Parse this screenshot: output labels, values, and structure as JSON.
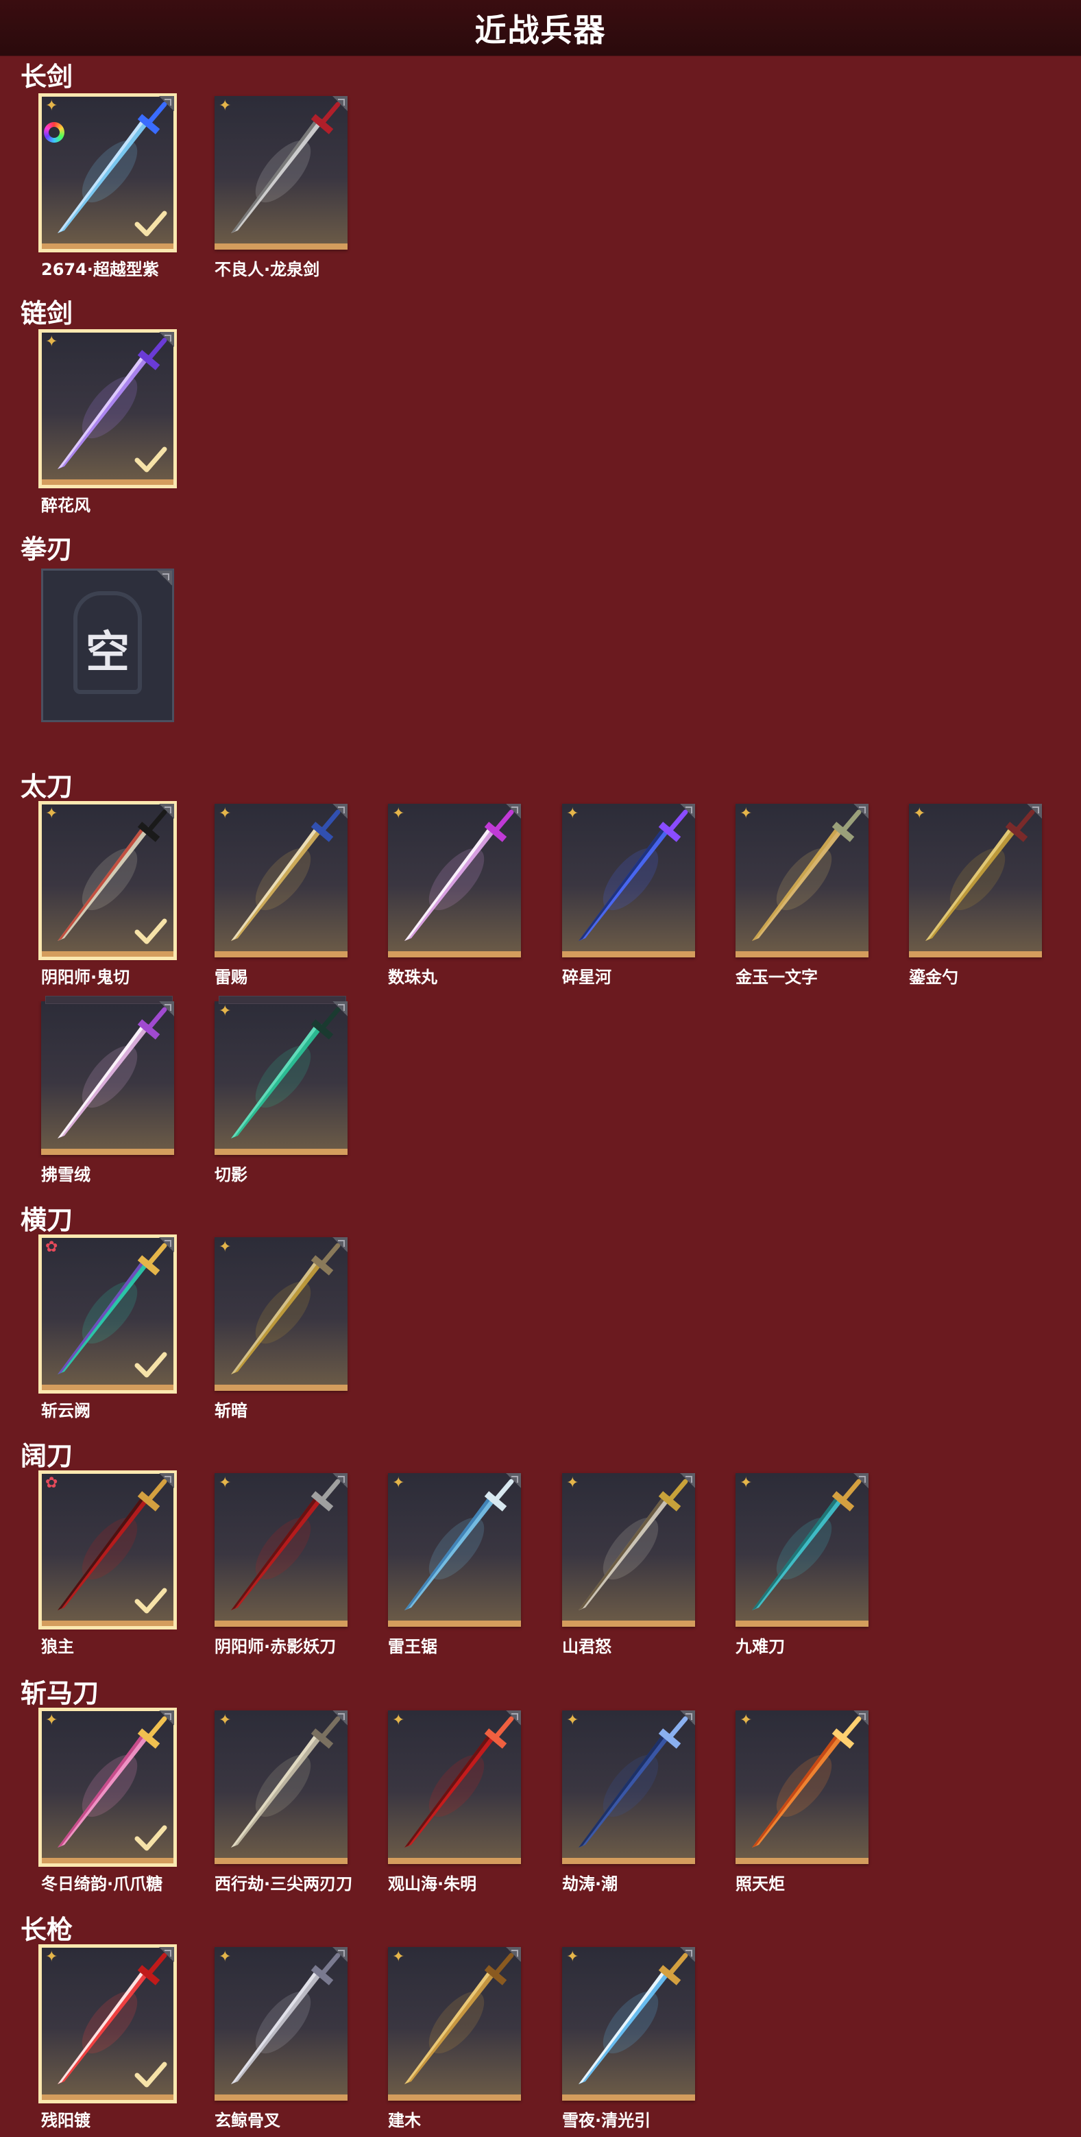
{
  "title": "近战兵器",
  "colors": {
    "background": "#6b1a1f",
    "card_bottom": "#d49d5d",
    "selected": "#fbe8b0",
    "rarity_gold": "#e5b54a",
    "rarity_red": "#e64a5a"
  },
  "sections": [
    {
      "name": "长剑",
      "items": [
        {
          "label": "2674·超越型紫",
          "rarity": "gold",
          "selected": true,
          "badge": "rainbow-ring"
        },
        {
          "label": "不良人·龙泉剑",
          "rarity": "gold",
          "selected": false
        }
      ]
    },
    {
      "name": "链剑",
      "items": [
        {
          "label": "醉花风",
          "rarity": "gold",
          "selected": true
        }
      ]
    },
    {
      "name": "拳刃",
      "items": [
        {
          "label": "",
          "empty_text": "空",
          "empty": true
        }
      ]
    },
    {
      "name": "太刀",
      "items": [
        {
          "label": "阴阳师·鬼切",
          "rarity": "gold",
          "selected": true
        },
        {
          "label": "雷赐",
          "rarity": "gold",
          "selected": false
        },
        {
          "label": "数珠丸",
          "rarity": "gold",
          "selected": false
        },
        {
          "label": "碎星河",
          "rarity": "gold",
          "selected": false
        },
        {
          "label": "金玉一文字",
          "rarity": "gold",
          "selected": false
        },
        {
          "label": "鎏金勺",
          "rarity": "gold",
          "selected": false
        },
        {
          "label": "拂雪绒",
          "rarity": "none",
          "selected": false,
          "stack": true
        },
        {
          "label": "切影",
          "rarity": "gold",
          "selected": false,
          "stack": true
        }
      ]
    },
    {
      "name": "横刀",
      "items": [
        {
          "label": "斩云阙",
          "rarity": "red",
          "selected": true
        },
        {
          "label": "斩暗",
          "rarity": "gold",
          "selected": false
        }
      ]
    },
    {
      "name": "阔刀",
      "items": [
        {
          "label": "狼主",
          "rarity": "red",
          "selected": true
        },
        {
          "label": "阴阳师·赤影妖刀",
          "rarity": "gold",
          "selected": false
        },
        {
          "label": "雷王锯",
          "rarity": "gold",
          "selected": false
        },
        {
          "label": "山君怒",
          "rarity": "gold",
          "selected": false
        },
        {
          "label": "九难刀",
          "rarity": "gold",
          "selected": false
        }
      ]
    },
    {
      "name": "斩马刀",
      "items": [
        {
          "label": "冬日绮韵·爪爪糖",
          "rarity": "gold",
          "selected": true
        },
        {
          "label": "西行劫·三尖两刃刀",
          "rarity": "gold",
          "selected": false
        },
        {
          "label": "观山海·朱明",
          "rarity": "gold",
          "selected": false
        },
        {
          "label": "劫涛·潮",
          "rarity": "gold",
          "selected": false
        },
        {
          "label": "照天炬",
          "rarity": "gold",
          "selected": false
        }
      ]
    },
    {
      "name": "长枪",
      "items": [
        {
          "label": "残阳镀",
          "rarity": "gold",
          "selected": true
        },
        {
          "label": "玄鲸骨叉",
          "rarity": "gold",
          "selected": false
        },
        {
          "label": "建木",
          "rarity": "gold",
          "selected": false
        },
        {
          "label": "雪夜·清光引",
          "rarity": "gold",
          "selected": false
        }
      ]
    }
  ]
}
